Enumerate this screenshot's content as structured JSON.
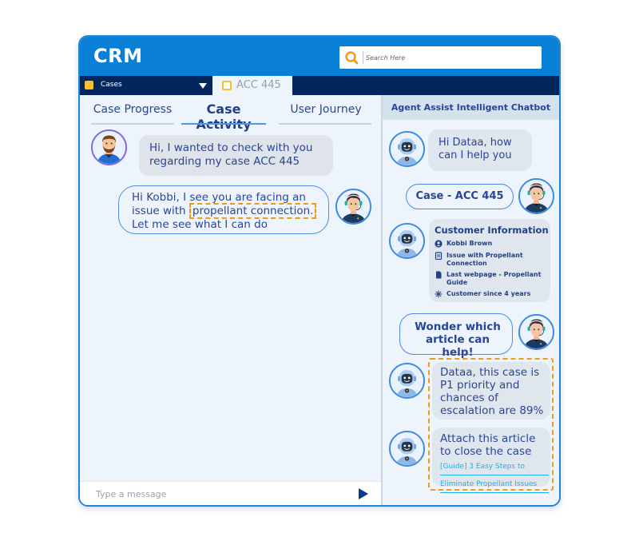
{
  "app": {
    "title": "CRM",
    "search_placeholder": "Search Here"
  },
  "tabbar": {
    "module_dropdown": "Cases",
    "open_tab": "ACC 445"
  },
  "left_pane": {
    "tabs": [
      {
        "label": "Case Progress",
        "active": false
      },
      {
        "label": "Case Activity",
        "active": true
      },
      {
        "label": "User Journey",
        "active": false
      }
    ],
    "messages": [
      {
        "sender": "customer",
        "text": "Hi, I wanted to check with you regarding my case ACC 445"
      },
      {
        "sender": "agent",
        "text_before": "Hi Kobbi, I see you are facing an issue with",
        "highlight": "propellant connection.",
        "text_after": "Let me see what I can do"
      }
    ],
    "composer_placeholder": "Type a message"
  },
  "right_pane": {
    "title": "Agent Assist Intelligent Chatbot",
    "messages": [
      {
        "sender": "bot",
        "text": "Hi Dataa, how can I help you"
      },
      {
        "sender": "agent",
        "text": "Case - ACC 445"
      },
      {
        "sender": "bot",
        "card": {
          "title": "Customer Information",
          "rows": [
            {
              "icon": "user-circle-icon",
              "text": "Kobbi Brown"
            },
            {
              "icon": "clipboard-icon",
              "text": "Issue with Propellant Connection"
            },
            {
              "icon": "document-icon",
              "text": "Last webpage - Propellant Guide"
            },
            {
              "icon": "sparkle-icon",
              "text": "Customer since 4 years"
            }
          ]
        }
      },
      {
        "sender": "agent",
        "text": "Wonder which article can help!"
      },
      {
        "sender": "bot",
        "text": "Dataa, this case is P1 priority and chances of escalation are 89%"
      },
      {
        "sender": "bot",
        "text": "Attach this article to close the case",
        "link_line1": "[Guide] 3 Easy Steps to",
        "link_line2": "Eliminate Propellant Issues"
      }
    ]
  },
  "colors": {
    "header_blue": "#0a7fd6",
    "navy": "#03275c",
    "accent_orange": "#f29a18",
    "tab_yellow": "#fbbf2c",
    "link_cyan": "#1db0e8",
    "text_blue": "#2a4596"
  }
}
